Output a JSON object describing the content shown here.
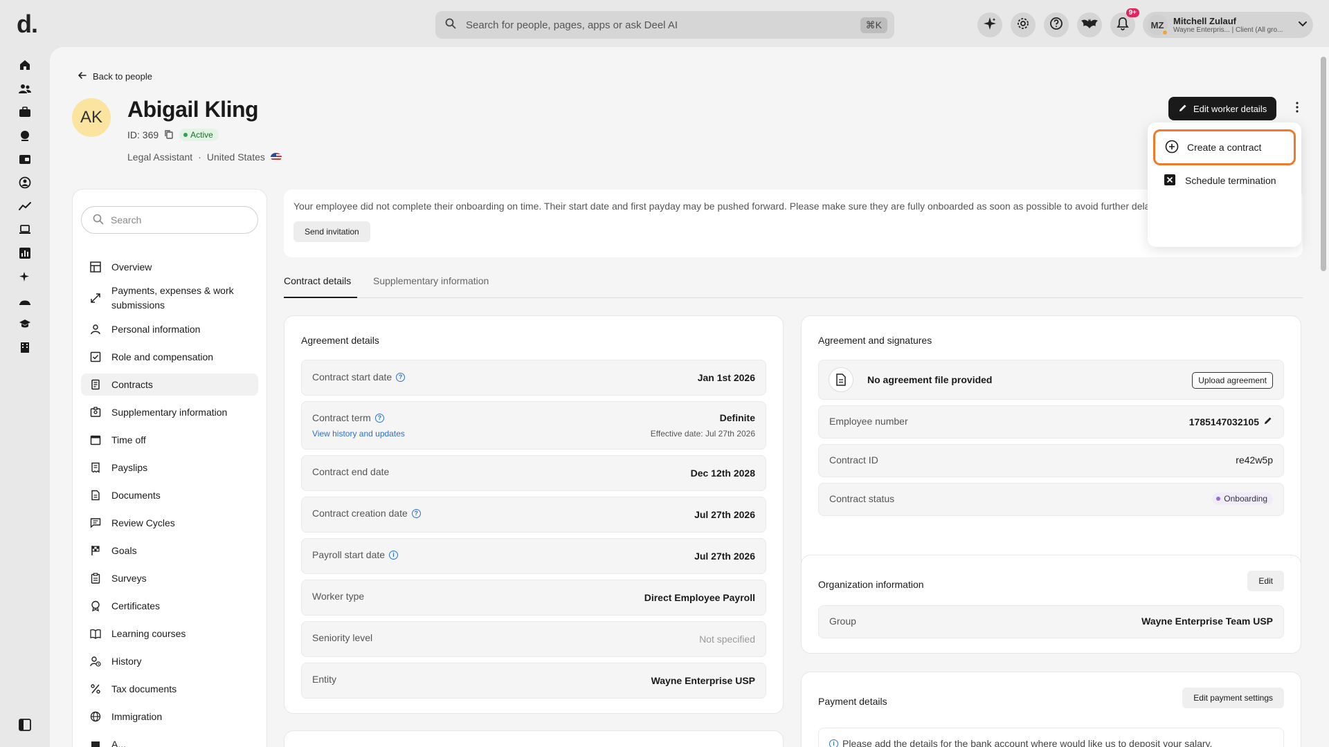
{
  "topbar": {
    "logo": "d.",
    "search_placeholder": "Search for people, pages, apps or ask Deel AI",
    "search_shortcut": "⌘K",
    "notif_count": "9+",
    "user_initials": "MZ",
    "user_name": "Mitchell Zulauf",
    "user_sub": "Wayne Enterpris... | Client (All gro..."
  },
  "header": {
    "back_label": "Back to people",
    "avatar_initials": "AK",
    "name": "Abigail Kling",
    "id_label": "ID: 369",
    "status": "Active",
    "role": "Legal Assistant",
    "separator": "·",
    "country": "United States",
    "edit_button": "Edit worker details"
  },
  "dropdown": {
    "items": [
      {
        "label": "Create a contract",
        "icon": "plus-circle-icon"
      },
      {
        "label": "Schedule termination",
        "icon": "close-box-icon"
      }
    ]
  },
  "sidenav": {
    "search_placeholder": "Search",
    "items": [
      {
        "label": "Overview",
        "icon": "layout-icon"
      },
      {
        "label": "Payments, expenses & work submissions",
        "icon": "arrows-icon"
      },
      {
        "label": "Personal information",
        "icon": "person-icon"
      },
      {
        "label": "Role and compensation",
        "icon": "check-box-icon"
      },
      {
        "label": "Contracts",
        "icon": "contract-icon"
      },
      {
        "label": "Supplementary information",
        "icon": "id-card-icon"
      },
      {
        "label": "Time off",
        "icon": "calendar-icon"
      },
      {
        "label": "Payslips",
        "icon": "receipt-icon"
      },
      {
        "label": "Documents",
        "icon": "document-icon"
      },
      {
        "label": "Review Cycles",
        "icon": "chat-icon"
      },
      {
        "label": "Goals",
        "icon": "flag-icon"
      },
      {
        "label": "Surveys",
        "icon": "clipboard-icon"
      },
      {
        "label": "Certificates",
        "icon": "badge-icon"
      },
      {
        "label": "Learning courses",
        "icon": "book-icon"
      },
      {
        "label": "History",
        "icon": "history-icon"
      },
      {
        "label": "Tax documents",
        "icon": "percent-icon"
      },
      {
        "label": "Immigration",
        "icon": "globe-icon"
      },
      {
        "label": "A...",
        "icon": "more-icon"
      }
    ]
  },
  "banner": {
    "text": "Your employee did not complete their onboarding on time. Their start date and first payday may be pushed forward. Please make sure they are fully onboarded as soon as possible to avoid further delays.",
    "button": "Send invitation"
  },
  "tabs": [
    {
      "label": "Contract details"
    },
    {
      "label": "Supplementary information"
    }
  ],
  "agreement": {
    "title": "Agreement details",
    "rows": [
      {
        "label": "Contract start date",
        "value": "Jan 1st 2026"
      },
      {
        "label": "Contract term",
        "value": "Definite",
        "link": "View history and updates",
        "sub": "Effective date: Jul 27th 2026"
      },
      {
        "label": "Contract end date",
        "value": "Dec 12th 2028"
      },
      {
        "label": "Contract creation date",
        "value": "Jul 27th 2026"
      },
      {
        "label": "Payroll start date",
        "value": "Jul 27th 2026"
      },
      {
        "label": "Worker type",
        "value": "Direct Employee Payroll"
      },
      {
        "label": "Seniority level",
        "value": "Not specified"
      },
      {
        "label": "Entity",
        "value": "Wayne Enterprise USP"
      }
    ]
  },
  "signatures": {
    "title": "Agreement and signatures",
    "file_text": "No agreement file provided",
    "upload_button": "Upload agreement",
    "rows": [
      {
        "label": "Employee number",
        "value": "1785147032105"
      },
      {
        "label": "Contract ID",
        "value": "re42w5p"
      },
      {
        "label": "Contract status",
        "value": "Onboarding"
      }
    ]
  },
  "organization": {
    "title": "Organization information",
    "edit_button": "Edit",
    "group_label": "Group",
    "group_value": "Wayne Enterprise Team USP"
  },
  "payment": {
    "title": "Payment details",
    "edit_button": "Edit payment settings",
    "notice": "Please add the details for the bank account where would like us to deposit your salary."
  },
  "colors": {
    "accent_focus": "#f07a2a",
    "active_green": "#2ea44f",
    "onboarding_purple": "#9a6ad6",
    "link_blue": "#2a6fd6"
  }
}
